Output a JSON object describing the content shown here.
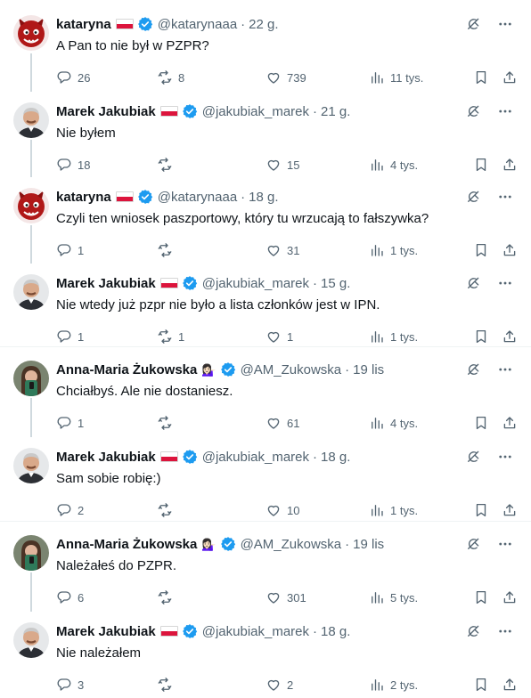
{
  "colors": {
    "verified": "#1d9bf0",
    "muted": "#536471",
    "text": "#0f1419",
    "line": "#cfd9de",
    "flag_red": "#dc143c"
  },
  "tweets": [
    {
      "name": "kataryna",
      "flag": true,
      "handle": "@katarynaaa",
      "time": "22 g.",
      "text": "A Pan to nie był w PZPR?",
      "reply": "26",
      "retweet": "8",
      "like": "739",
      "views": "11 tys.",
      "avatar": "devil"
    },
    {
      "name": "Marek Jakubiak",
      "flag": true,
      "handle": "@jakubiak_marek",
      "time": "21 g.",
      "text": "Nie byłem",
      "reply": "18",
      "retweet": "",
      "like": "15",
      "views": "4 tys.",
      "avatar": "man"
    },
    {
      "name": "kataryna",
      "flag": true,
      "handle": "@katarynaaa",
      "time": "18 g.",
      "text": "Czyli ten wniosek paszportowy, który tu wrzucają to fałszywka?",
      "reply": "1",
      "retweet": "",
      "like": "31",
      "views": "1 tys.",
      "avatar": "devil"
    },
    {
      "name": "Marek Jakubiak",
      "flag": true,
      "handle": "@jakubiak_marek",
      "time": "15 g.",
      "text": "Nie wtedy już pzpr nie było a lista członków jest w IPN.",
      "reply": "1",
      "retweet": "1",
      "like": "1",
      "views": "1 tys.",
      "avatar": "man"
    },
    {
      "name": "Anna-Maria Żukowska",
      "emoji": "💁🏻‍♀️",
      "handle": "@AM_Zukowska",
      "time": "19 lis",
      "text": "Chciałbyś. Ale nie dostaniesz.",
      "reply": "1",
      "retweet": "",
      "like": "61",
      "views": "4 tys.",
      "avatar": "woman"
    },
    {
      "name": "Marek Jakubiak",
      "flag": true,
      "handle": "@jakubiak_marek",
      "time": "18 g.",
      "text": "Sam sobie robię:)",
      "reply": "2",
      "retweet": "",
      "like": "10",
      "views": "1 tys.",
      "avatar": "man"
    },
    {
      "name": "Anna-Maria Żukowska",
      "emoji": "💁🏻‍♀️",
      "handle": "@AM_Zukowska",
      "time": "19 lis",
      "text": "Należałeś do PZPR.",
      "reply": "6",
      "retweet": "",
      "like": "301",
      "views": "5 tys.",
      "avatar": "woman"
    },
    {
      "name": "Marek Jakubiak",
      "flag": true,
      "handle": "@jakubiak_marek",
      "time": "18 g.",
      "text": "Nie należałem",
      "reply": "3",
      "retweet": "",
      "like": "2",
      "views": "2 tys.",
      "avatar": "man"
    }
  ],
  "icons": {
    "header": [
      "grok-icon",
      "more-icon"
    ],
    "actions": [
      "reply-icon",
      "retweet-icon",
      "like-icon",
      "views-icon",
      "bookmark-icon",
      "share-icon"
    ]
  }
}
